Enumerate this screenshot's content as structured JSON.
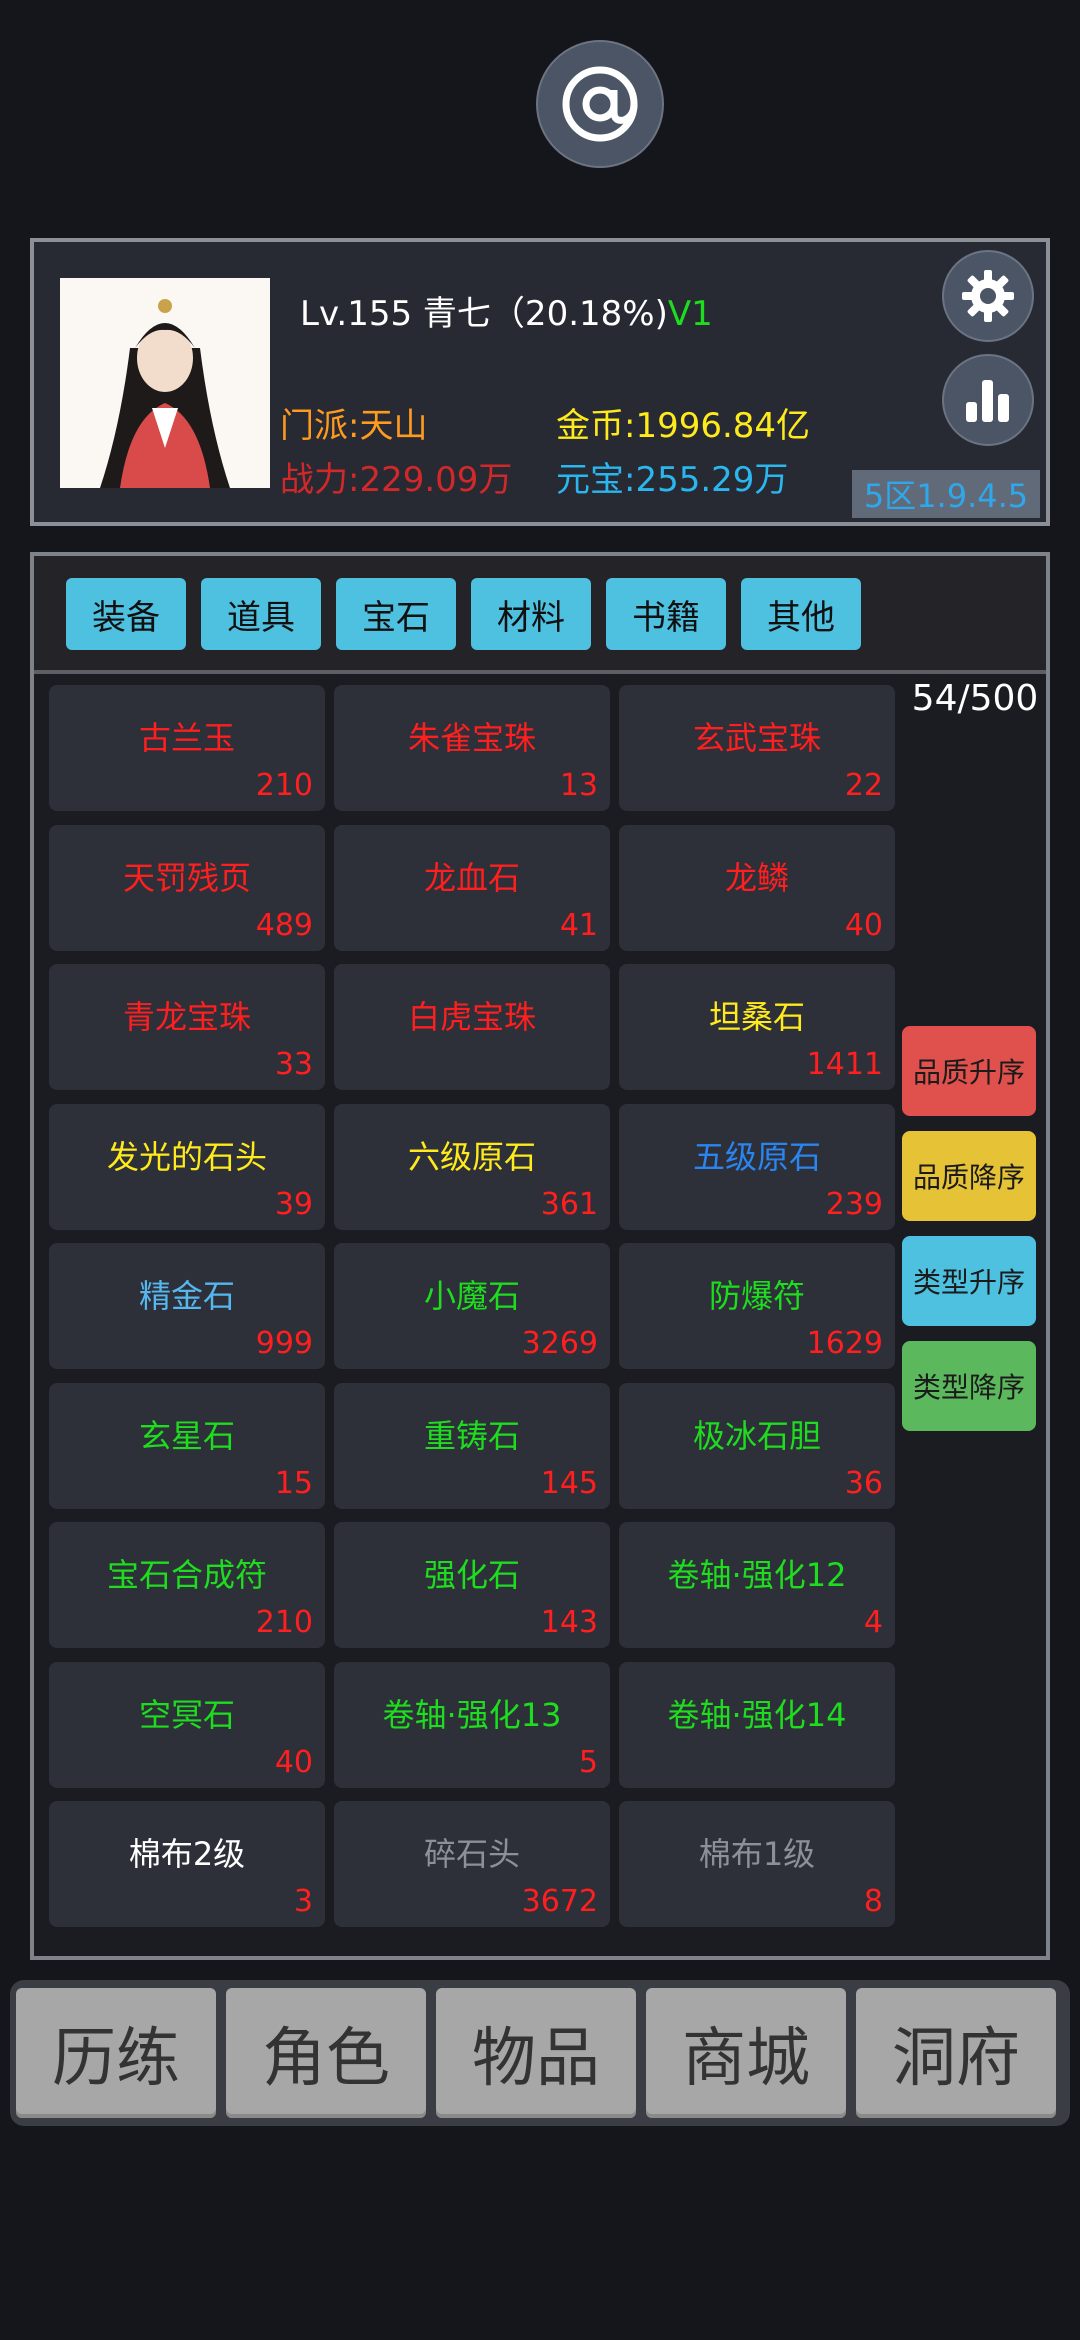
{
  "colors": {
    "red": "#ff1f1f",
    "yellow": "#ffea1c",
    "blue": "#2a86ee",
    "lightblue": "#56b6ee",
    "green": "#1edc1e",
    "white": "#ffffff",
    "gray": "#8e9099",
    "accent_tab": "#4ec0e0"
  },
  "top_icon": "at-sign-icon",
  "profile": {
    "level_text": "Lv.155 青七（20.18%)",
    "vip": "V1",
    "sect": "门派:天山",
    "power": "战力:229.09万",
    "gold": "金币:1996.84亿",
    "yuanbao": "元宝:255.29万",
    "server": "5区1.9.4.5",
    "settings_icon": "gear-icon",
    "stats_icon": "bar-chart-icon"
  },
  "tabs": [
    "装备",
    "道具",
    "宝石",
    "材料",
    "书籍",
    "其他"
  ],
  "capacity": "54/500",
  "items": [
    {
      "name": "古兰玉",
      "count": "210",
      "color": "#ff1f1f"
    },
    {
      "name": "朱雀宝珠",
      "count": "13",
      "color": "#ff1f1f"
    },
    {
      "name": "玄武宝珠",
      "count": "22",
      "color": "#ff1f1f"
    },
    {
      "name": "天罚残页",
      "count": "489",
      "color": "#ff1f1f"
    },
    {
      "name": "龙血石",
      "count": "41",
      "color": "#ff1f1f"
    },
    {
      "name": "龙鳞",
      "count": "40",
      "color": "#ff1f1f"
    },
    {
      "name": "青龙宝珠",
      "count": "33",
      "color": "#ff1f1f"
    },
    {
      "name": "白虎宝珠",
      "count": "",
      "color": "#ff1f1f"
    },
    {
      "name": "坦桑石",
      "count": "1411",
      "color": "#ffea1c"
    },
    {
      "name": "发光的石头",
      "count": "39",
      "color": "#ffea1c"
    },
    {
      "name": "六级原石",
      "count": "361",
      "color": "#ffea1c"
    },
    {
      "name": "五级原石",
      "count": "239",
      "color": "#2a86ee"
    },
    {
      "name": "精金石",
      "count": "999",
      "color": "#56b6ee"
    },
    {
      "name": "小魔石",
      "count": "3269",
      "color": "#1edc1e"
    },
    {
      "name": "防爆符",
      "count": "1629",
      "color": "#1edc1e"
    },
    {
      "name": "玄星石",
      "count": "15",
      "color": "#1edc1e"
    },
    {
      "name": "重铸石",
      "count": "145",
      "color": "#1edc1e"
    },
    {
      "name": "极冰石胆",
      "count": "36",
      "color": "#1edc1e"
    },
    {
      "name": "宝石合成符",
      "count": "210",
      "color": "#1edc1e"
    },
    {
      "name": "强化石",
      "count": "143",
      "color": "#1edc1e"
    },
    {
      "name": "卷轴·强化12",
      "count": "4",
      "color": "#1edc1e"
    },
    {
      "name": "空冥石",
      "count": "40",
      "color": "#1edc1e"
    },
    {
      "name": "卷轴·强化13",
      "count": "5",
      "color": "#1edc1e"
    },
    {
      "name": "卷轴·强化14",
      "count": "",
      "color": "#1edc1e"
    },
    {
      "name": "棉布2级",
      "count": "3",
      "color": "#ffffff"
    },
    {
      "name": "碎石头",
      "count": "3672",
      "color": "#8e9099"
    },
    {
      "name": "棉布1级",
      "count": "8",
      "color": "#8e9099"
    }
  ],
  "sort_buttons": [
    {
      "label": "品质升序",
      "color": "#e0504c"
    },
    {
      "label": "品质降序",
      "color": "#e6c336"
    },
    {
      "label": "类型升序",
      "color": "#4ec0e0"
    },
    {
      "label": "类型降序",
      "color": "#5cb85c"
    }
  ],
  "bottom_nav": [
    "历练",
    "角色",
    "物品",
    "商城",
    "洞府"
  ]
}
